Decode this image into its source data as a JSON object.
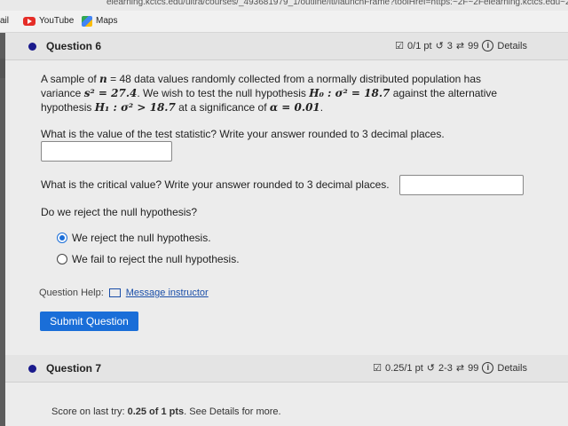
{
  "browser": {
    "url": "elearning.kctcs.edu/ultra/courses/_493681979_1/outline/lti/launchFrame?toolHref=https:~2F~2Felearning.kctcs.edu~2F",
    "bookmarks": [
      {
        "label": "ail"
      },
      {
        "label": "YouTube",
        "icon": "youtube-icon"
      },
      {
        "label": "Maps",
        "icon": "maps-icon"
      }
    ]
  },
  "question6": {
    "title": "Question 6",
    "points": "0/1 pt",
    "retries": "3",
    "attempts": "99",
    "details": "Details",
    "prompt_line1_a": "A sample of ",
    "n_var": "n",
    "prompt_line1_b": " = 48 data values randomly collected from a normally distributed population has",
    "prompt_line2_a": "variance ",
    "s2": "s² = 27.4",
    "prompt_line2_b": ". We wish to test the null hypothesis ",
    "h0": "H₀ : σ² = 18.7",
    "prompt_line2_c": " against the alternative",
    "prompt_line3_a": "hypothesis ",
    "h1": "H₁ : σ² > 18.7",
    "prompt_line3_b": " at a significance of ",
    "alpha": "α = 0.01",
    "prompt_line3_c": ".",
    "q_test_stat": "What is the value of the test statistic? Write your answer rounded to 3 decimal places.",
    "test_stat_value": "",
    "q_critical": "What is the critical value? Write your answer rounded to 3 decimal places.",
    "critical_value": "",
    "q_reject": "Do we reject the null hypothesis?",
    "options": [
      {
        "label": "We reject the null hypothesis.",
        "selected": true
      },
      {
        "label": "We fail to reject the null hypothesis.",
        "selected": false
      }
    ],
    "help_label": "Question Help:",
    "message_link": "Message instructor",
    "submit_label": "Submit Question"
  },
  "question7": {
    "title": "Question 7",
    "points": "0.25/1 pt",
    "retries": "2-3",
    "attempts": "99",
    "details": "Details",
    "score_prefix": "Score on last try: ",
    "score_value": "0.25 of 1 pts",
    "score_suffix": ". See Details for more."
  }
}
